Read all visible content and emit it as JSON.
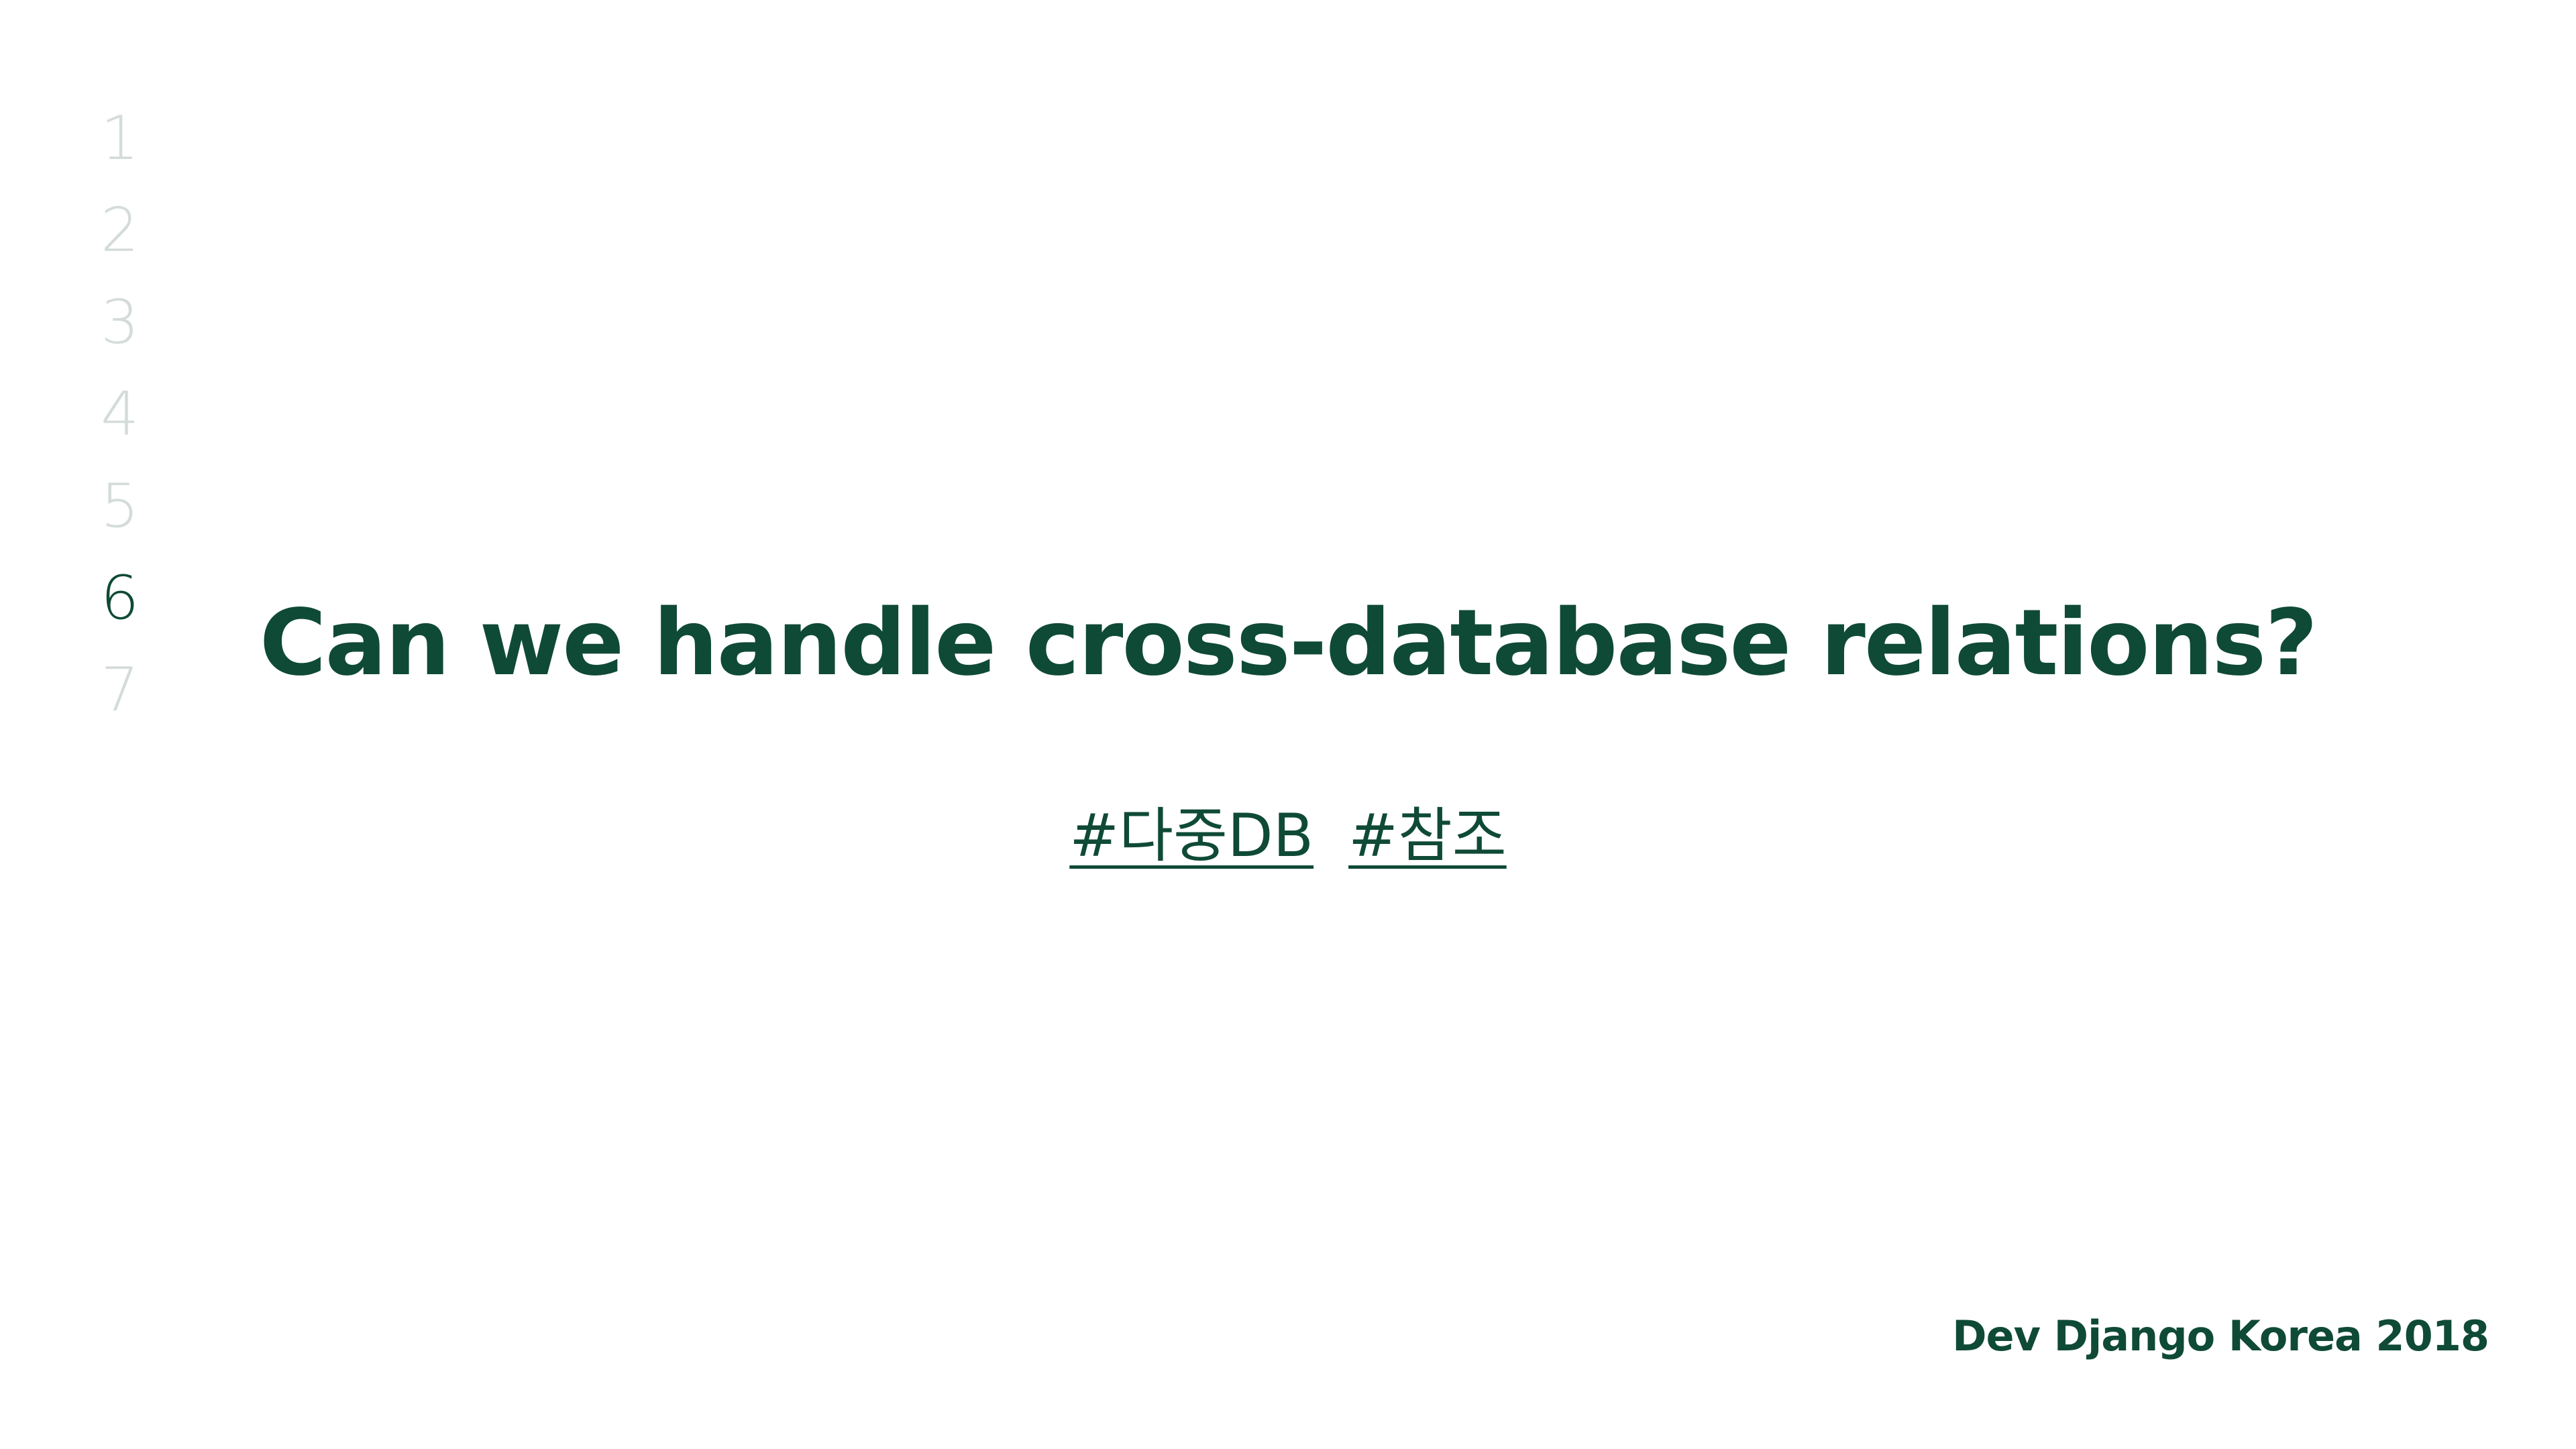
{
  "slide_index": {
    "items": [
      "1",
      "2",
      "3",
      "4",
      "5",
      "6",
      "7"
    ],
    "active": "6"
  },
  "title": "Can we handle cross-database relations?",
  "tags": [
    "#다중DB",
    "#참조"
  ],
  "footer": "Dev Django Korea 2018",
  "colors": {
    "primary": "#0f4a36",
    "inactive_index": "#d4dcd9",
    "background": "#ffffff"
  }
}
